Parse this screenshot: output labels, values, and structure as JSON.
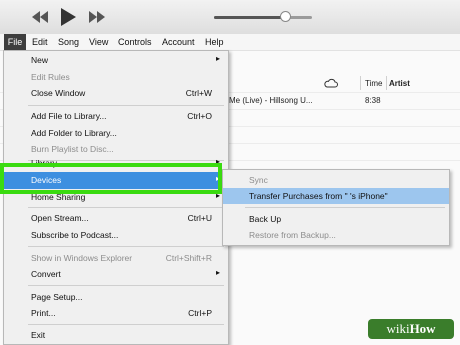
{
  "toolbar": {
    "volume_level": 0.72
  },
  "menubar": [
    {
      "label": "File",
      "active": true
    },
    {
      "label": "Edit"
    },
    {
      "label": "Song"
    },
    {
      "label": "View"
    },
    {
      "label": "Controls"
    },
    {
      "label": "Account"
    },
    {
      "label": "Help"
    }
  ],
  "library": {
    "columns": {
      "time": "Time",
      "artist": "Artist"
    },
    "row": {
      "title": "Me (Live) - Hillsong U...",
      "time": "8:38"
    }
  },
  "file_menu": {
    "items": [
      {
        "label": "New",
        "shortcut": "",
        "submenu": true,
        "disabled": false
      },
      {
        "label": "Edit Rules",
        "shortcut": "",
        "submenu": false,
        "disabled": true
      },
      {
        "label": "Close Window",
        "shortcut": "Ctrl+W",
        "submenu": false,
        "disabled": false
      },
      {
        "label": "Add File to Library...",
        "shortcut": "Ctrl+O",
        "submenu": false,
        "disabled": false
      },
      {
        "label": "Add Folder to Library...",
        "shortcut": "",
        "submenu": false,
        "disabled": false
      },
      {
        "label": "Burn Playlist to Disc...",
        "shortcut": "",
        "submenu": false,
        "disabled": true
      },
      {
        "label": "Library",
        "shortcut": "",
        "submenu": true,
        "disabled": false
      },
      {
        "label": "Devices",
        "shortcut": "",
        "submenu": true,
        "disabled": false,
        "highlighted": true
      },
      {
        "label": "Home Sharing",
        "shortcut": "",
        "submenu": true,
        "disabled": false
      },
      {
        "label": "Open Stream...",
        "shortcut": "Ctrl+U",
        "submenu": false,
        "disabled": false
      },
      {
        "label": "Subscribe to Podcast...",
        "shortcut": "",
        "submenu": false,
        "disabled": false
      },
      {
        "label": "Show in Windows Explorer",
        "shortcut": "Ctrl+Shift+R",
        "submenu": false,
        "disabled": true
      },
      {
        "label": "Convert",
        "shortcut": "",
        "submenu": true,
        "disabled": false
      },
      {
        "label": "Page Setup...",
        "shortcut": "",
        "submenu": false,
        "disabled": false
      },
      {
        "label": "Print...",
        "shortcut": "Ctrl+P",
        "submenu": false,
        "disabled": false
      },
      {
        "label": "Exit",
        "shortcut": "",
        "submenu": false,
        "disabled": false
      }
    ]
  },
  "devices_submenu": {
    "items": [
      {
        "label": "Sync",
        "disabled": true
      },
      {
        "label": "Transfer Purchases from \"      's iPhone\"",
        "disabled": false,
        "highlighted": true
      },
      {
        "label": "Back Up",
        "disabled": false
      },
      {
        "label": "Restore from Backup...",
        "disabled": true
      }
    ]
  },
  "watermark": {
    "prefix": "wiki",
    "suffix": "How"
  },
  "colors": {
    "highlight": "#3d8fe0",
    "green_box": "#3adb10",
    "submenu_highlight": "#9dc6ee"
  }
}
